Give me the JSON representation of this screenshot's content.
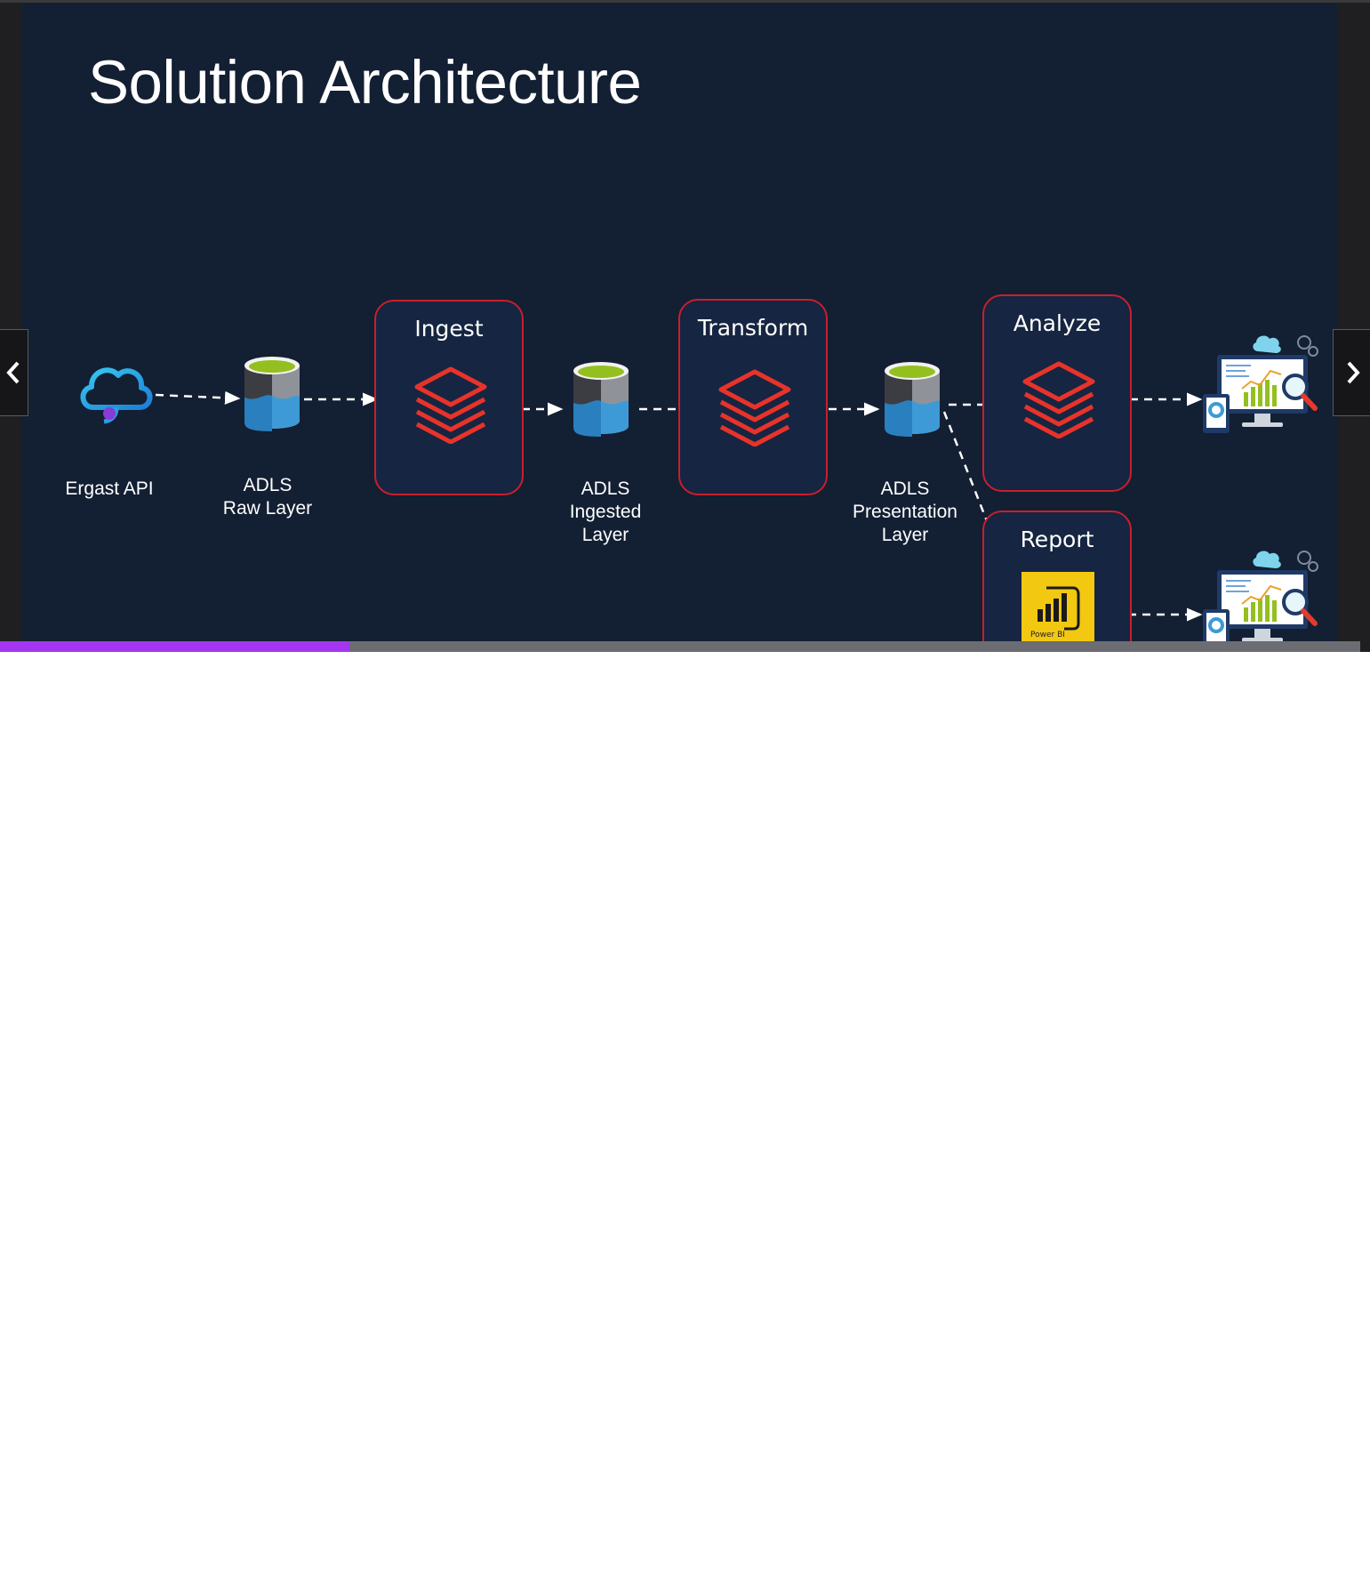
{
  "slide": {
    "title": "Solution Architecture",
    "nodes": {
      "ergast_api": "Ergast API",
      "adls_raw": [
        "ADLS",
        "Raw Layer"
      ],
      "adls_ingested": [
        "ADLS",
        "Ingested",
        "Layer"
      ],
      "adls_presentation": [
        "ADLS",
        "Presentation",
        "Layer"
      ]
    },
    "stages": {
      "ingest": "Ingest",
      "transform": "Transform",
      "analyze": "Analyze",
      "report": "Report"
    },
    "power_bi_label": "Power BI"
  },
  "icons": {
    "api": "cloud-api-icon",
    "storage": "data-lake-storage-icon",
    "databricks": "databricks-layers-icon",
    "power_bi": "power-bi-icon",
    "dashboard": "analytics-dashboard-icon",
    "prev": "chevron-left-icon",
    "next": "chevron-right-icon"
  },
  "progress": {
    "fraction": 0.257
  },
  "colors": {
    "slide_bg": "#131f33",
    "stage_border": "#c91f2b",
    "databricks_red": "#e8332a",
    "progress_fill": "#a435f0",
    "progress_track": "#6b6d73",
    "power_bi_yellow": "#f2c811"
  }
}
